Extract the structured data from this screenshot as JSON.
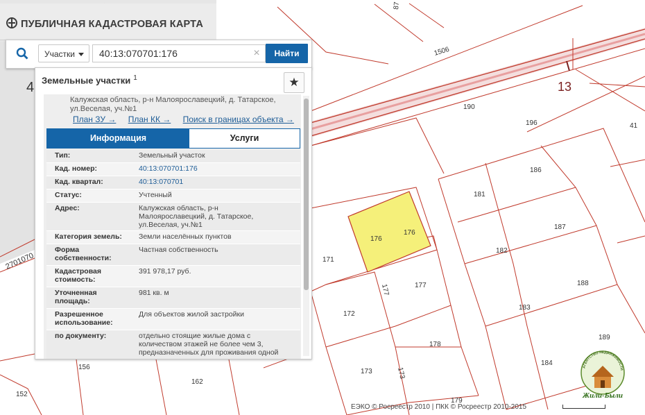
{
  "app": {
    "title": "ПУБЛИЧНАЯ КАДАСТРОВАЯ КАРТА"
  },
  "search": {
    "type_selected": "Участки",
    "query": "40:13:070701:176",
    "clear_symbol": "×",
    "button_label": "Найти"
  },
  "panel": {
    "title": "Земельные участки",
    "count": "1",
    "star_symbol": "★",
    "address_header": "Калужская область, р-н Малоярославецкий, д. Татарское, ул.Веселая, уч.№1",
    "links": [
      "План ЗУ →",
      "План КК →",
      "Поиск в границах объекта →"
    ],
    "tabs": {
      "info": "Информация",
      "services": "Услуги"
    },
    "rows": [
      {
        "label": "Тип:",
        "value": "Земельный участок"
      },
      {
        "label": "Кад. номер:",
        "value": "40:13:070701:176"
      },
      {
        "label": "Кад. квартал:",
        "value": "40:13:070701"
      },
      {
        "label": "Статус:",
        "value": "Учтенный"
      },
      {
        "label": "Адрес:",
        "value": "Калужская область, р-н Малоярославецкий, д. Татарское, ул.Веселая, уч.№1"
      },
      {
        "label": "Категория земель:",
        "value": "Земли населённых пунктов"
      },
      {
        "label": "Форма собственности:",
        "value": "Частная собственность"
      },
      {
        "label": "Кадастровая стоимость:",
        "value": "391 978,17 руб."
      },
      {
        "label": "Уточненная площадь:",
        "value": "981 кв. м"
      },
      {
        "label": "Разрешенное использование:",
        "value": "Для объектов жилой застройки"
      },
      {
        "label": "по документу:",
        "value": "отдельно стоящие жилые дома с количеством этажей не более чем 3, предназначенных для проживания одной семьи"
      }
    ]
  },
  "map": {
    "parcel_labels": [
      "87",
      "1506",
      "13",
      "190",
      "196",
      "41",
      "186",
      "181",
      "187",
      "176",
      "176",
      "182",
      "171",
      "177",
      "177",
      "188",
      "172",
      "183",
      "178",
      "189",
      "156",
      "162",
      "173",
      "173",
      "184",
      "152",
      "179",
      "2701070",
      "4"
    ],
    "highlight_color": "#f5f07a",
    "boundary_color": "#c0392b"
  },
  "attribution": "ЕЭКО © Росреестр 2010 | ПКК © Росреестр 2010-2015",
  "watermark": {
    "top_text": "АГЕНТСТВО НЕДВИЖИМОСТИ",
    "bottom_text": "Жили-Были"
  }
}
